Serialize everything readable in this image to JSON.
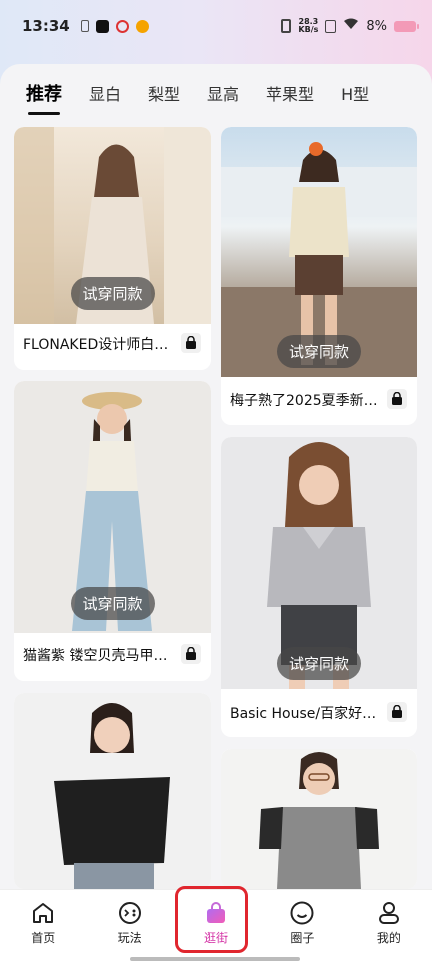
{
  "status_bar": {
    "time": "13:34",
    "net_speed_top": "28.3",
    "net_speed_bottom": "KB/s",
    "battery": "8%"
  },
  "tabs": [
    {
      "label": "推荐",
      "active": true
    },
    {
      "label": "显白"
    },
    {
      "label": "梨型"
    },
    {
      "label": "显高"
    },
    {
      "label": "苹果型"
    },
    {
      "label": "H型"
    }
  ],
  "try_on_label": "试穿同款",
  "cards": [
    {
      "title": "FLONAKED设计师白…",
      "colors": [
        "#efe3d2",
        "#d7c3aa"
      ]
    },
    {
      "title": "梅子熟了2025夏季新…",
      "colors": [
        "#b9cfe2",
        "#9b8c7a"
      ]
    },
    {
      "title": "猫酱紫 镂空贝壳马甲…",
      "colors": [
        "#ebe9e6",
        "#b9cfdc"
      ]
    },
    {
      "title": "Basic House/百家好…",
      "colors": [
        "#e9e9ea",
        "#b7b7bb"
      ]
    },
    {
      "title": "",
      "colors": [
        "#f1f1f1",
        "#3b3b3b"
      ]
    },
    {
      "title": "",
      "colors": [
        "#f3f3f2",
        "#5a5a5a"
      ]
    }
  ],
  "nav": [
    {
      "label": "首页",
      "icon": "home-icon"
    },
    {
      "label": "玩法",
      "icon": "play-icon"
    },
    {
      "label": "逛街",
      "icon": "shopping-bag-icon",
      "active": true
    },
    {
      "label": "圈子",
      "icon": "circle-smile-icon"
    },
    {
      "label": "我的",
      "icon": "profile-icon"
    }
  ],
  "colors": {
    "active_nav": "#d433a6",
    "highlight": "#e0262e"
  }
}
